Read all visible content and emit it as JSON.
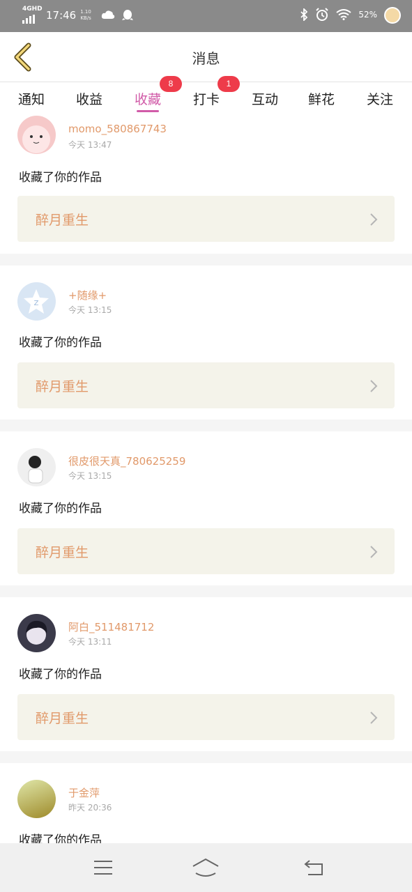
{
  "status_bar": {
    "network": "4GHD",
    "time": "17:46",
    "speed_value": "1.10",
    "speed_unit": "KB/s",
    "battery": "52%"
  },
  "header": {
    "title": "消息",
    "back_icon": "chevron-left-icon"
  },
  "tabs": [
    {
      "label": "通知",
      "badge": ""
    },
    {
      "label": "收益",
      "badge": ""
    },
    {
      "label": "收藏",
      "badge": "8",
      "active": true
    },
    {
      "label": "打卡",
      "badge": "1"
    },
    {
      "label": "互动",
      "badge": ""
    },
    {
      "label": "鲜花",
      "badge": ""
    },
    {
      "label": "关注",
      "badge": ""
    }
  ],
  "feed": [
    {
      "user": "momo_580867743",
      "time": "今天 13:47",
      "action": "收藏了你的作品",
      "work": "醉月重生",
      "avatar_color": "#f6c9c9"
    },
    {
      "user": "+随缘+",
      "time": "今天 13:15",
      "action": "收藏了你的作品",
      "work": "醉月重生",
      "avatar_color": "#d9e6f4"
    },
    {
      "user": "很皮很天真_780625259",
      "time": "今天 13:15",
      "action": "收藏了你的作品",
      "work": "醉月重生",
      "avatar_color": "#efefef"
    },
    {
      "user": "阿白_511481712",
      "time": "今天 13:11",
      "action": "收藏了你的作品",
      "work": "醉月重生",
      "avatar_color": "#3b3a4a"
    },
    {
      "user": "于金萍",
      "time": "昨天 20:36",
      "action": "收藏了你的作品",
      "work": "",
      "avatar_color": "#a39a3a"
    }
  ],
  "colors": {
    "accent": "#d15ba8",
    "name": "#e1996a",
    "badge": "#ee3b4a"
  },
  "nav": {
    "menu_icon": "menu-icon",
    "home_icon": "home-icon",
    "back_icon": "back-arrow-icon"
  }
}
